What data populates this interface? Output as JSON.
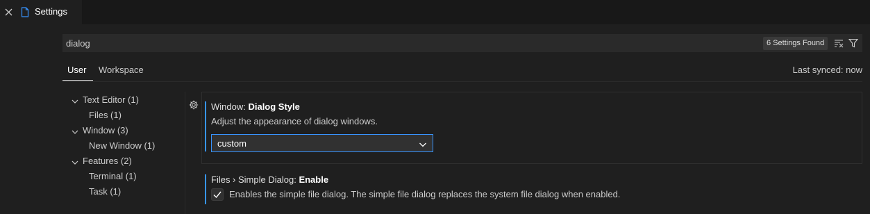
{
  "tab": {
    "label": "Settings"
  },
  "search": {
    "value": "dialog",
    "found": "6 Settings Found"
  },
  "scope": {
    "user": "User",
    "workspace": "Workspace",
    "last_synced": "Last synced: now"
  },
  "toc": [
    {
      "label": "Text Editor (1)",
      "expanded": true
    },
    {
      "label": "Files (1)"
    },
    {
      "label": "Window (3)",
      "expanded": true
    },
    {
      "label": "New Window (1)"
    },
    {
      "label": "Features (2)",
      "expanded": true
    },
    {
      "label": "Terminal (1)"
    },
    {
      "label": "Task (1)"
    }
  ],
  "settings": [
    {
      "category": "Window: ",
      "name": "Dialog Style",
      "description": "Adjust the appearance of dialog windows.",
      "value": "custom"
    },
    {
      "category": "Files › Simple Dialog: ",
      "name": "Enable",
      "description": "Enables the simple file dialog. The simple file dialog replaces the system file dialog when enabled.",
      "checked": true
    }
  ],
  "colors": {
    "accent": "#3794ff",
    "background": "#1f1f1f"
  }
}
